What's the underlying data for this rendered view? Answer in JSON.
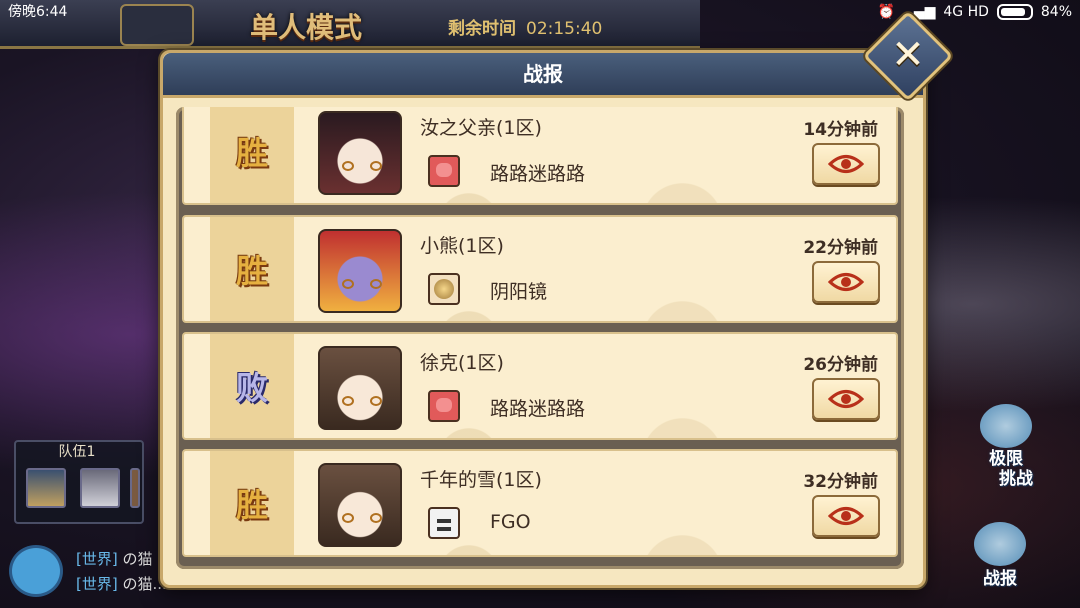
{
  "status_bar": {
    "time": "傍晚6:44",
    "network": "4G HD",
    "battery": "84%"
  },
  "top": {
    "mode_title": "单人模式",
    "time_left_label": "剩余时间",
    "time_left_value": "02:15:40"
  },
  "dialog": {
    "title": "战报",
    "close_symbol": "✕",
    "records": [
      {
        "result": "胜",
        "outcome": "win",
        "player": "汝之父亲(1区)",
        "time_ago": "14分钟前",
        "team_icon": "red-face-icon",
        "team_name": "路路迷路路",
        "avatar": "a1"
      },
      {
        "result": "胜",
        "outcome": "win",
        "player": "小熊(1区)",
        "time_ago": "22分钟前",
        "team_icon": "mirror-icon",
        "team_name": "阴阳镜",
        "avatar": "a2"
      },
      {
        "result": "败",
        "outcome": "lose",
        "player": "徐克(1区)",
        "time_ago": "26分钟前",
        "team_icon": "red-face-icon",
        "team_name": "路路迷路路",
        "avatar": "a3"
      },
      {
        "result": "胜",
        "outcome": "win",
        "player": "千年的雪(1区)",
        "time_ago": "32分钟前",
        "team_icon": "white-face-icon",
        "team_name": "FGO",
        "avatar": "a3"
      }
    ]
  },
  "left_hud": {
    "team_label": "队伍1",
    "chat": [
      {
        "channel": "[世界]",
        "text": "の猫"
      },
      {
        "channel": "[世界]",
        "text": "の猫..."
      }
    ]
  },
  "right_hud": {
    "limit_challenge": [
      "极限",
      "挑战"
    ],
    "battle_report": "战报"
  },
  "colors": {
    "win": "#e6b040",
    "lose": "#b7b6e8",
    "header": "#3a4d6a",
    "panel": "#f6e7c0"
  }
}
